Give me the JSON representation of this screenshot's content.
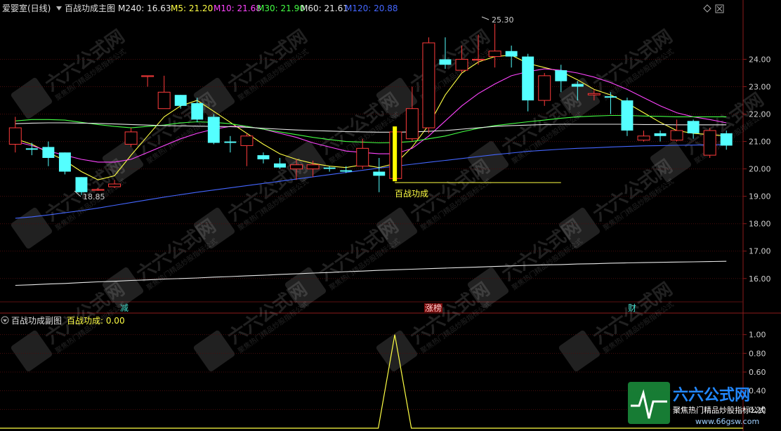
{
  "header": {
    "stock_name": "爱婴室(日线)",
    "main_indicator": "百战功成主图",
    "ma_labels": [
      {
        "text": "M240: 16.63",
        "color": "#e8e8e8"
      },
      {
        "text": "M5: 21.20",
        "color": "#ffff44"
      },
      {
        "text": "M10: 21.68",
        "color": "#ff44ff"
      },
      {
        "text": "M30: 21.90",
        "color": "#44ff44"
      },
      {
        "text": "M60: 21.61",
        "color": "#e8e8e8"
      },
      {
        "text": "M120: 20.88",
        "color": "#4466ff"
      }
    ]
  },
  "sub_header": {
    "title": "百战功成副图",
    "indicator_label": "百战功成: 0.00"
  },
  "annotations": {
    "high_label": "25.30",
    "low_label": "18.85",
    "signal_label": "百战功成",
    "tag_left": "减",
    "tag_mid": "涨榜",
    "tag_right": "财"
  },
  "watermark": {
    "brand": "六六公式网",
    "slogan": "聚焦热门精品炒股指标公式",
    "url": "www.66gsw.com"
  },
  "chart_data": [
    {
      "type": "candlestick",
      "title": "百战功成主图",
      "ylim": [
        15.2,
        25.6
      ],
      "y_ticks": [
        16.0,
        17.0,
        18.0,
        19.0,
        20.0,
        21.0,
        22.0,
        23.0,
        24.0
      ],
      "candles": [
        {
          "o": 20.9,
          "c": 21.5,
          "h": 21.9,
          "l": 20.6
        },
        {
          "o": 20.75,
          "c": 20.7,
          "h": 20.95,
          "l": 20.5
        },
        {
          "o": 20.8,
          "c": 20.4,
          "h": 21.0,
          "l": 20.1
        },
        {
          "o": 20.6,
          "c": 19.9,
          "h": 20.6,
          "l": 19.8
        },
        {
          "o": 19.7,
          "c": 19.15,
          "h": 19.7,
          "l": 19.05
        },
        {
          "o": 19.25,
          "c": 19.25,
          "h": 19.3,
          "l": 19.2
        },
        {
          "o": 19.35,
          "c": 19.45,
          "h": 19.6,
          "l": 19.3
        },
        {
          "o": 20.9,
          "c": 21.35,
          "h": 21.5,
          "l": 20.8
        },
        {
          "o": 23.4,
          "c": 23.4,
          "h": 23.4,
          "l": 23.0
        },
        {
          "o": 22.2,
          "c": 22.8,
          "h": 23.4,
          "l": 22.2
        },
        {
          "o": 22.7,
          "c": 22.3,
          "h": 22.7,
          "l": 22.2
        },
        {
          "o": 22.4,
          "c": 21.8,
          "h": 22.6,
          "l": 21.7
        },
        {
          "o": 21.9,
          "c": 20.95,
          "h": 22.0,
          "l": 20.9
        },
        {
          "o": 21.0,
          "c": 20.95,
          "h": 21.2,
          "l": 20.6
        },
        {
          "o": 20.85,
          "c": 21.2,
          "h": 21.3,
          "l": 20.1
        },
        {
          "o": 20.5,
          "c": 20.35,
          "h": 20.6,
          "l": 20.2
        },
        {
          "o": 20.2,
          "c": 20.05,
          "h": 20.4,
          "l": 20.0
        },
        {
          "o": 20.0,
          "c": 20.15,
          "h": 20.35,
          "l": 19.6
        },
        {
          "o": 20.0,
          "c": 20.15,
          "h": 20.3,
          "l": 19.7
        },
        {
          "o": 20.05,
          "c": 20.0,
          "h": 20.1,
          "l": 19.9
        },
        {
          "o": 19.95,
          "c": 19.9,
          "h": 20.1,
          "l": 19.85
        },
        {
          "o": 20.1,
          "c": 20.75,
          "h": 21.1,
          "l": 20.0
        },
        {
          "o": 19.9,
          "c": 19.75,
          "h": 20.4,
          "l": 19.15
        },
        {
          "o": 19.65,
          "c": 21.35,
          "h": 21.35,
          "l": 19.55
        },
        {
          "o": 21.1,
          "c": 22.2,
          "h": 23.0,
          "l": 21.0
        },
        {
          "o": 21.5,
          "c": 24.6,
          "h": 24.8,
          "l": 21.3
        },
        {
          "o": 24.0,
          "c": 23.8,
          "h": 24.8,
          "l": 23.65
        },
        {
          "o": 23.6,
          "c": 24.0,
          "h": 24.5,
          "l": 23.5
        },
        {
          "o": 24.0,
          "c": 24.0,
          "h": 24.9,
          "l": 23.8
        },
        {
          "o": 24.1,
          "c": 24.3,
          "h": 25.3,
          "l": 23.7
        },
        {
          "o": 24.3,
          "c": 24.1,
          "h": 24.5,
          "l": 23.7
        },
        {
          "o": 24.1,
          "c": 22.5,
          "h": 24.2,
          "l": 22.1
        },
        {
          "o": 22.5,
          "c": 23.4,
          "h": 23.5,
          "l": 22.3
        },
        {
          "o": 23.6,
          "c": 23.2,
          "h": 23.8,
          "l": 22.8
        },
        {
          "o": 23.1,
          "c": 23.0,
          "h": 23.2,
          "l": 22.5
        },
        {
          "o": 22.7,
          "c": 22.75,
          "h": 22.9,
          "l": 22.5
        },
        {
          "o": 22.65,
          "c": 22.6,
          "h": 22.8,
          "l": 22.0
        },
        {
          "o": 22.5,
          "c": 21.4,
          "h": 22.6,
          "l": 21.2
        },
        {
          "o": 21.05,
          "c": 21.2,
          "h": 21.4,
          "l": 21.0
        },
        {
          "o": 21.3,
          "c": 21.2,
          "h": 21.4,
          "l": 21.0
        },
        {
          "o": 21.05,
          "c": 21.4,
          "h": 21.8,
          "l": 21.0
        },
        {
          "o": 21.75,
          "c": 21.3,
          "h": 21.8,
          "l": 21.1
        },
        {
          "o": 20.5,
          "c": 21.4,
          "h": 21.5,
          "l": 20.4
        },
        {
          "o": 21.3,
          "c": 20.85,
          "h": 21.4,
          "l": 20.7
        }
      ],
      "series": [
        {
          "name": "M5",
          "color": "#ffff44",
          "values": [
            21.1,
            20.9,
            20.6,
            20.3,
            19.9,
            19.6,
            19.75,
            20.5,
            21.2,
            21.9,
            22.3,
            22.5,
            22.1,
            21.7,
            21.3,
            20.9,
            20.55,
            20.35,
            20.2,
            20.1,
            20.05,
            20.15,
            20.05,
            20.2,
            20.8,
            21.6,
            22.7,
            23.5,
            23.9,
            24.1,
            24.15,
            23.85,
            23.7,
            23.55,
            23.25,
            22.9,
            22.7,
            22.4,
            22.05,
            21.7,
            21.4,
            21.3,
            21.25,
            21.2
          ]
        },
        {
          "name": "M10",
          "color": "#ff44ff",
          "values": [
            21.0,
            20.85,
            20.65,
            20.5,
            20.35,
            20.25,
            20.25,
            20.35,
            20.6,
            20.85,
            21.1,
            21.3,
            21.45,
            21.55,
            21.55,
            21.45,
            21.3,
            21.15,
            20.95,
            20.8,
            20.65,
            20.6,
            20.55,
            20.55,
            20.75,
            21.2,
            21.75,
            22.3,
            22.75,
            23.1,
            23.4,
            23.55,
            23.65,
            23.6,
            23.5,
            23.35,
            23.15,
            22.9,
            22.6,
            22.3,
            22.05,
            21.9,
            21.8,
            21.68
          ]
        },
        {
          "name": "M30",
          "color": "#44ff44",
          "values": [
            21.75,
            21.8,
            21.8,
            21.78,
            21.7,
            21.62,
            21.55,
            21.5,
            21.55,
            21.6,
            21.68,
            21.72,
            21.7,
            21.65,
            21.55,
            21.45,
            21.35,
            21.25,
            21.15,
            21.07,
            21.0,
            20.98,
            20.95,
            20.96,
            21.0,
            21.1,
            21.2,
            21.35,
            21.48,
            21.58,
            21.65,
            21.72,
            21.78,
            21.85,
            21.9,
            21.93,
            21.95,
            21.95,
            21.93,
            21.92,
            21.9,
            21.9,
            21.9,
            21.9
          ]
        },
        {
          "name": "M60",
          "color": "#e8e8e8",
          "values": [
            21.65,
            21.67,
            21.68,
            21.68,
            21.67,
            21.66,
            21.64,
            21.62,
            21.6,
            21.58,
            21.57,
            21.56,
            21.55,
            21.54,
            21.52,
            21.48,
            21.45,
            21.42,
            21.4,
            21.38,
            21.36,
            21.35,
            21.34,
            21.34,
            21.35,
            21.37,
            21.4,
            21.45,
            21.5,
            21.55,
            21.58,
            21.6,
            21.62,
            21.63,
            21.63,
            21.63,
            21.63,
            21.63,
            21.62,
            21.62,
            21.61,
            21.61,
            21.61,
            21.61
          ]
        },
        {
          "name": "M120",
          "color": "#4466ff",
          "values": [
            18.2,
            18.25,
            18.32,
            18.4,
            18.48,
            18.57,
            18.67,
            18.77,
            18.87,
            18.97,
            19.06,
            19.15,
            19.23,
            19.31,
            19.39,
            19.47,
            19.55,
            19.63,
            19.71,
            19.79,
            19.87,
            19.95,
            20.03,
            20.1,
            20.17,
            20.24,
            20.31,
            20.38,
            20.45,
            20.52,
            20.58,
            20.64,
            20.68,
            20.72,
            20.75,
            20.77,
            20.8,
            20.82,
            20.84,
            20.85,
            20.86,
            20.87,
            20.88,
            20.88
          ]
        },
        {
          "name": "M240",
          "color": "#e8e8e8",
          "values": [
            15.75,
            15.77,
            15.8,
            15.82,
            15.85,
            15.88,
            15.9,
            15.93,
            15.95,
            15.98,
            16.0,
            16.02,
            16.05,
            16.07,
            16.1,
            16.12,
            16.15,
            16.17,
            16.2,
            16.22,
            16.25,
            16.27,
            16.3,
            16.32,
            16.34,
            16.36,
            16.38,
            16.4,
            16.42,
            16.44,
            16.46,
            16.48,
            16.5,
            16.51,
            16.53,
            16.54,
            16.56,
            16.57,
            16.58,
            16.59,
            16.6,
            16.61,
            16.62,
            16.63
          ]
        }
      ],
      "signal_bar": {
        "index": 22,
        "low": 19.55,
        "high": 21.55,
        "line_level": 19.5
      }
    },
    {
      "type": "line",
      "title": "百战功成副图",
      "ylim": [
        0,
        1.08
      ],
      "y_ticks": [
        "1.00",
        "0.80",
        "0.60",
        "0.40",
        "0.20"
      ],
      "series": [
        {
          "name": "百战功成",
          "color": "#ffff44",
          "values": [
            0,
            0,
            0,
            0,
            0,
            0,
            0,
            0,
            0,
            0,
            0,
            0,
            0,
            0,
            0,
            0,
            0,
            0,
            0,
            0,
            0,
            0,
            1,
            0,
            0,
            0,
            0,
            0,
            0,
            0,
            0,
            0,
            0,
            0,
            0,
            0,
            0,
            0,
            0,
            0,
            0,
            0,
            0,
            0
          ]
        }
      ]
    }
  ]
}
